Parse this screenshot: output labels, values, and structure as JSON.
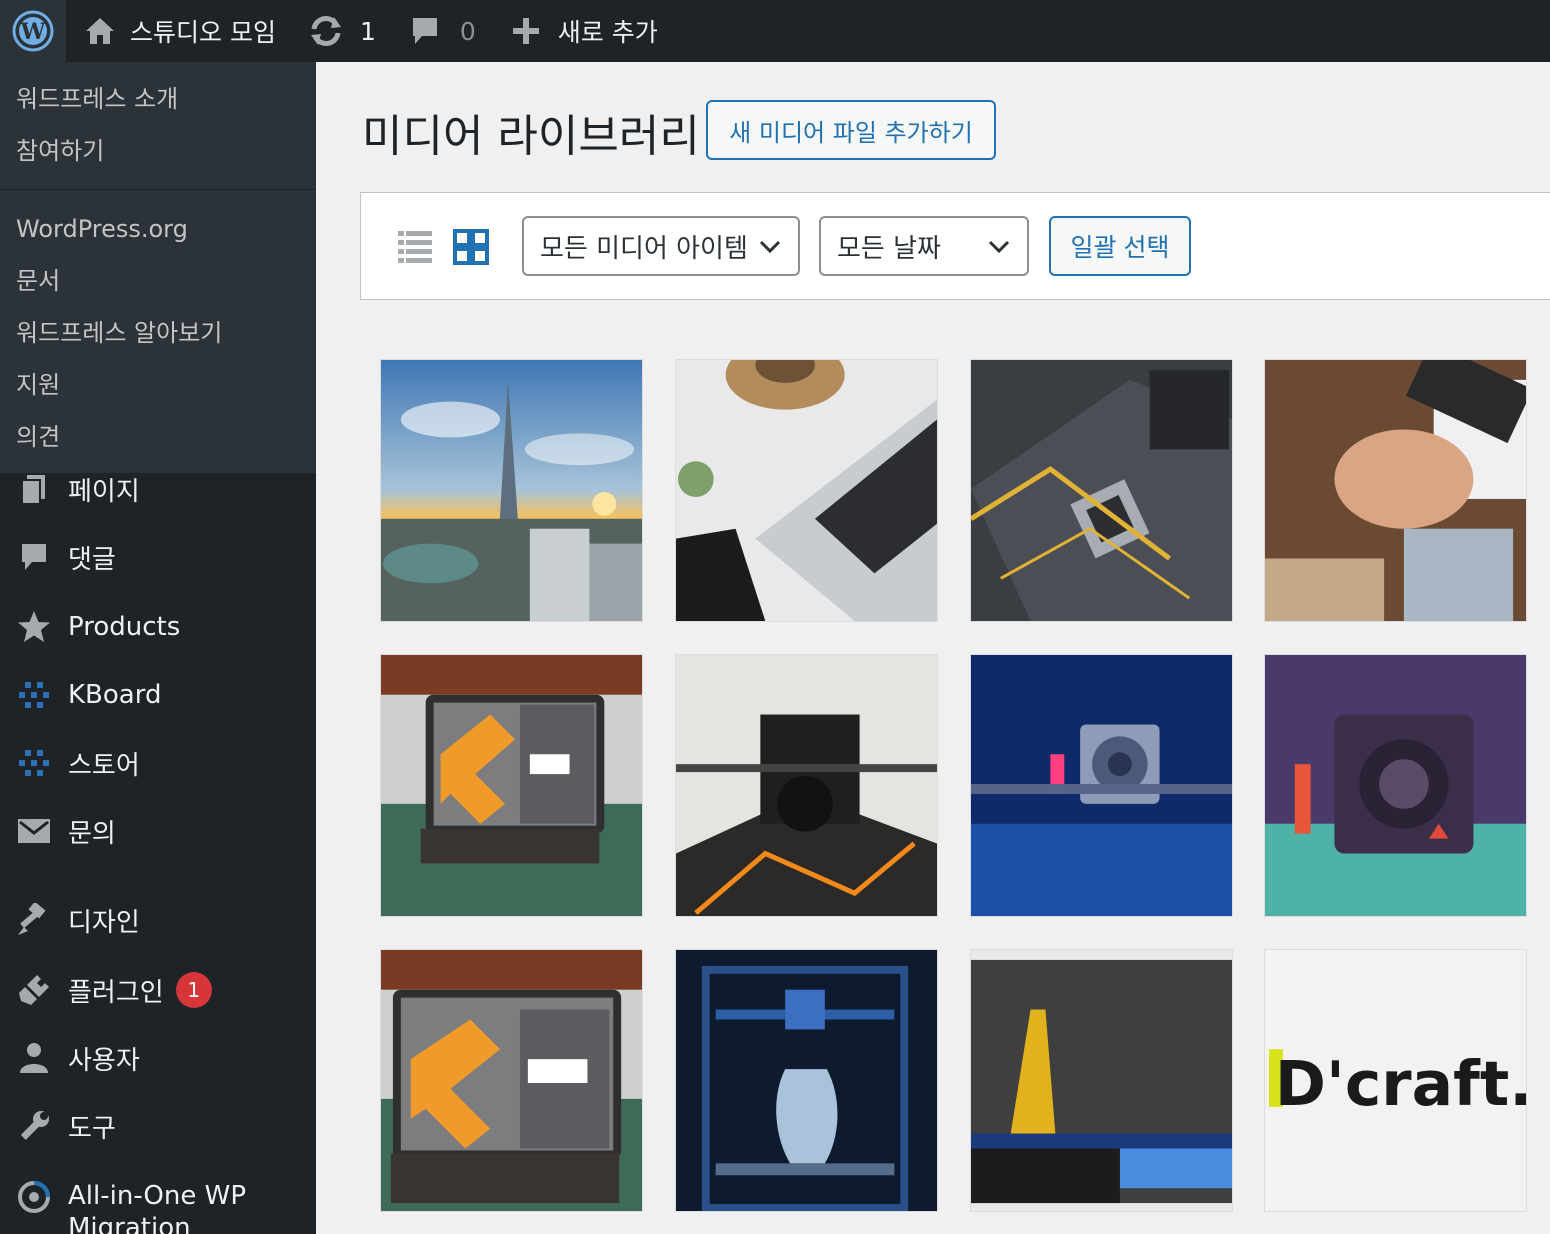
{
  "adminbar": {
    "site_name": "스튜디오 모임",
    "updates_count": "1",
    "comments_count": "0",
    "new_label": "새로 추가"
  },
  "wp_submenu": {
    "group1": [
      "워드프레스 소개",
      "참여하기"
    ],
    "group2": [
      "WordPress.org",
      "문서",
      "워드프레스 알아보기",
      "지원",
      "의견"
    ]
  },
  "menu": {
    "items": [
      {
        "label": "페이지",
        "icon": "page-icon"
      },
      {
        "label": "댓글",
        "icon": "comment-icon"
      },
      {
        "label": "Products",
        "icon": "star-icon"
      },
      {
        "label": "KBoard",
        "icon": "kboard-icon"
      },
      {
        "label": "스토어",
        "icon": "store-icon"
      },
      {
        "label": "문의",
        "icon": "mail-icon"
      },
      {
        "label": "디자인",
        "icon": "brush-icon"
      },
      {
        "label": "플러그인",
        "icon": "plugin-icon",
        "badge": "1"
      },
      {
        "label": "사용자",
        "icon": "user-icon"
      },
      {
        "label": "도구",
        "icon": "wrench-icon"
      },
      {
        "label": "All-in-One WP Migration",
        "icon": "migration-icon"
      }
    ]
  },
  "page": {
    "title": "미디어 라이브러리",
    "add_new_label": "새 미디어 파일 추가하기"
  },
  "toolbar": {
    "type_filter": "모든 미디어 아이템",
    "date_filter": "모든 날짜",
    "bulk_select_label": "일괄 선택"
  },
  "media": {
    "thumbnails": [
      {
        "name": "city-tower-photo"
      },
      {
        "name": "laptop-desk-photo"
      },
      {
        "name": "motherboard-photo"
      },
      {
        "name": "team-hands-photo"
      },
      {
        "name": "tablet-3d-model-photo"
      },
      {
        "name": "3d-printer-nozzle-photo"
      },
      {
        "name": "3d-printer-blue-photo"
      },
      {
        "name": "3d-printer-purple-photo"
      },
      {
        "name": "tablet-3d-model-photo-2"
      },
      {
        "name": "3d-printer-vase-photo"
      },
      {
        "name": "3d-print-yellow-photo"
      },
      {
        "name": "dcraft-logo"
      }
    ],
    "logo_text": "D'craft."
  },
  "colors": {
    "adminbar_bg": "#1d2327",
    "submenu_bg": "#2c3338",
    "accent": "#2271b1",
    "badge": "#d63638"
  }
}
